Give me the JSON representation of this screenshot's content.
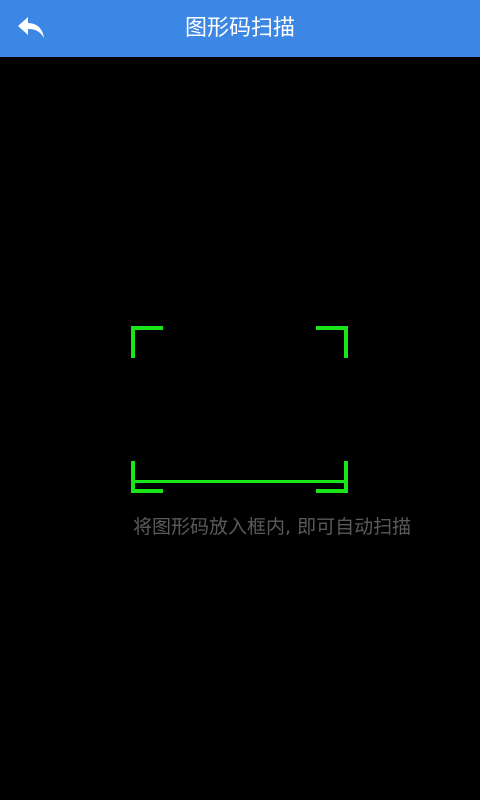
{
  "header": {
    "title": "图形码扫描",
    "back_icon": "back-arrow-icon",
    "bar_color": "#3d87e4"
  },
  "scanner": {
    "frame_color": "#19e619",
    "hint": "将图形码放入框内, 即可自动扫描"
  }
}
